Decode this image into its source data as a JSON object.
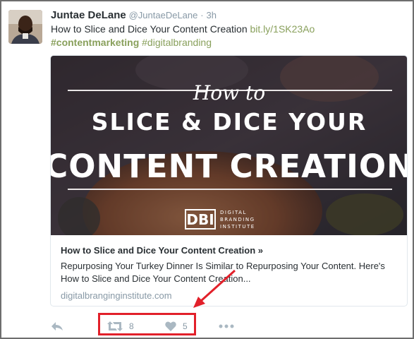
{
  "tweet": {
    "author_name": "Juntae DeLane",
    "author_handle": "@JuntaeDeLane",
    "separator": "·",
    "time": "3h",
    "text": "How to Slice and Dice Your Content Creation",
    "link": "bit.ly/1SK23Ao",
    "hashtags": [
      "#contentmarketing",
      "#digitalbranding"
    ]
  },
  "card": {
    "image_text": {
      "line1": "How to",
      "line2": "SLICE & DICE YOUR",
      "line3": "CONTENT CREATION",
      "logo_mark": "DBI",
      "logo_line1": "DIGITAL",
      "logo_line2": "BRANDING",
      "logo_line3": "INSTITUTE"
    },
    "title": "How to Slice and Dice Your Content Creation »",
    "description": "Repurposing Your Turkey Dinner Is Similar to Repurposing Your Content. Here's How to Slice and Dice Your Content Creation...",
    "domain": "digitalbranginginstitute.com"
  },
  "actions": {
    "reply_icon": "reply-icon",
    "retweet_icon": "retweet-icon",
    "retweet_count": "8",
    "like_icon": "heart-icon",
    "like_count": "5",
    "more_icon": "more-icon"
  },
  "annotation": {
    "highlight_color": "#e2202a"
  }
}
